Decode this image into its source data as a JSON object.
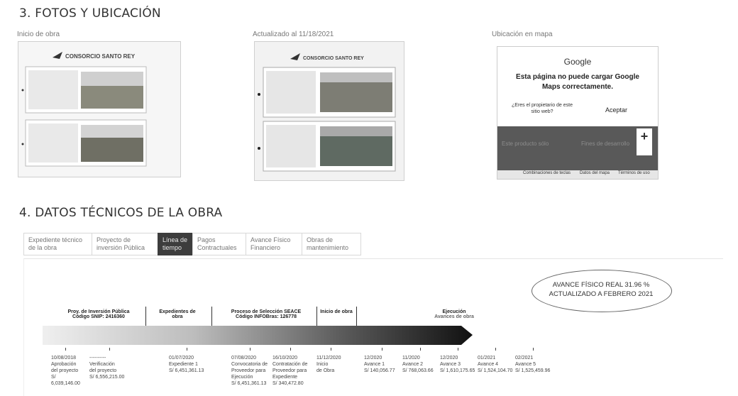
{
  "section3": {
    "title": "3. FOTOS Y UBICACIÓN",
    "photo1_caption": "Inicio de obra",
    "photo2_caption": "Actualizado al 11/18/2021",
    "map_caption": "Ubicación en mapa",
    "photo1_header": "CONSORCIO SANTO REY",
    "photo2_header": "CONSORCIO SANTO REY"
  },
  "map": {
    "google": "Google",
    "error": "Esta página no puede cargar Google Maps correctamente.",
    "owner_question": "¿Eres el propietario de este sitio web?",
    "accept": "Aceptar",
    "zoom_in": "+",
    "footer_shortcuts": "Combinaciones de teclas",
    "footer_data": "Datos del mapa",
    "footer_terms": "Términos de uso",
    "watermark_left": "Este producto sólo",
    "watermark_right": "Fines de desarrollo"
  },
  "section4": {
    "title": "4. DATOS TÉCNICOS DE LA OBRA",
    "tabs": [
      {
        "line1": "Expediente técnico",
        "line2": "de la obra"
      },
      {
        "line1": "Proyecto de",
        "line2": "inversión Pública"
      },
      {
        "line1": "Línea de",
        "line2": "tiempo"
      },
      {
        "line1": "Pagos",
        "line2": "Contractuales"
      },
      {
        "line1": "Avance Físico",
        "line2": "Financiero"
      },
      {
        "line1": "Obras de",
        "line2": "mantenimiento"
      }
    ]
  },
  "timeline": {
    "status_line1": "AVANCE FÍSICO REAL 31.96 %",
    "status_line2": "ACTUALIZADO A FEBRERO 2021",
    "phases": [
      {
        "title": "Proy. de Inversión Pública",
        "sub": "Código SNIP: 2416360"
      },
      {
        "title": "Expedientes de",
        "sub": "obra"
      },
      {
        "title": "Proceso de Selección SEACE",
        "sub": "Código INFOBras: 126778"
      },
      {
        "title": "Inicio de obra",
        "sub": ""
      },
      {
        "title": "Ejecución",
        "sub": "Avances de obra"
      }
    ],
    "milestones": [
      {
        "date": "10/08/2018",
        "l1": "Aprobación",
        "l2": "del proyecto",
        "l3": "S/ 6,039,146.00"
      },
      {
        "date": "----------",
        "l1": "Verificación",
        "l2": "del proyecto",
        "l3": "S/ 6,556,215.00"
      },
      {
        "date": "01/07/2020",
        "l1": "Expediente 1",
        "l2": "S/ 6,451,361.13",
        "l3": ""
      },
      {
        "date": "07/08/2020",
        "l1": "Convocatoria de",
        "l2": "Proveedor para",
        "l3": "Ejecución",
        "l4": "S/ 6,451,361.13"
      },
      {
        "date": "16/10/2020",
        "l1": "Contratación de",
        "l2": "Proveedor para",
        "l3": "Expediente",
        "l4": "S/ 340,472.80"
      },
      {
        "date": "11/12/2020",
        "l1": "Inicio",
        "l2": "de Obra",
        "l3": ""
      },
      {
        "date": "12/2020",
        "l1": "Avance 1",
        "l2": "S/ 140,056.77",
        "l3": ""
      },
      {
        "date": "11/2020",
        "l1": "Avance 2",
        "l2": "S/ 768,063.66",
        "l3": ""
      },
      {
        "date": "12/2020",
        "l1": "Avance 3",
        "l2": "S/ 1,610,175.65",
        "l3": ""
      },
      {
        "date": "01/2021",
        "l1": "Avance 4",
        "l2": "S/ 1,524,104.70",
        "l3": ""
      },
      {
        "date": "02/2021",
        "l1": "Avance 5",
        "l2": "S/ 1,525,459.96",
        "l3": ""
      }
    ]
  }
}
